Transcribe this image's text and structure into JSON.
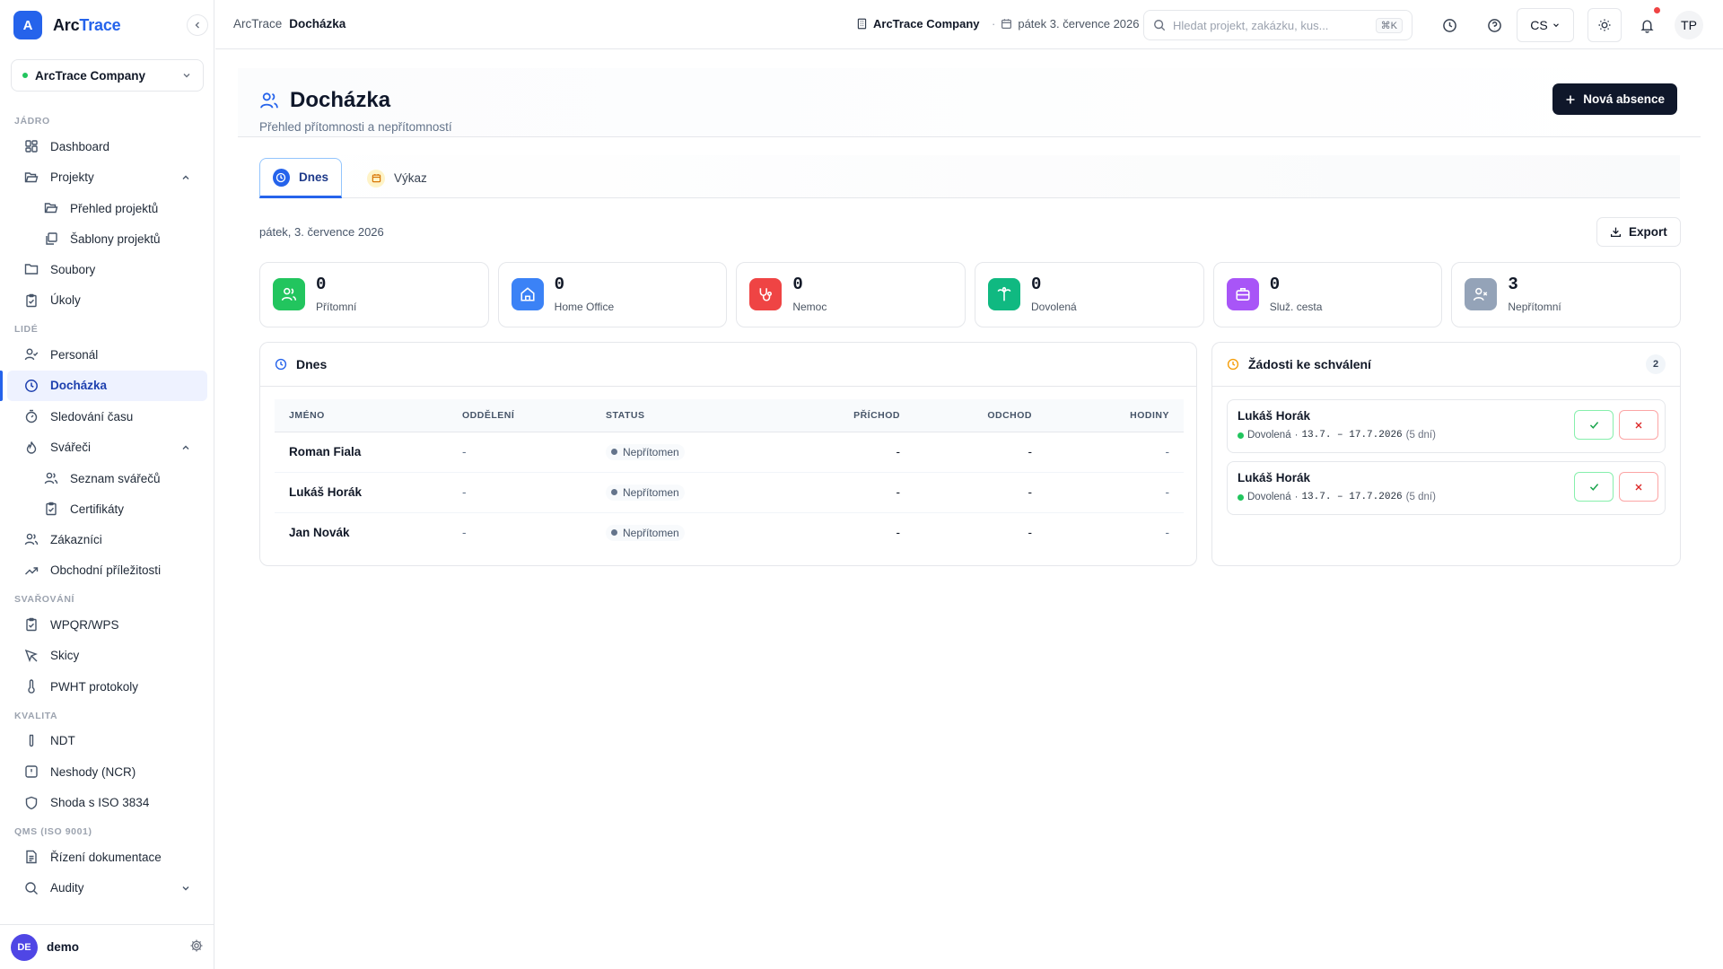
{
  "brand": {
    "logo_letter": "A",
    "name_a": "Arc",
    "name_b": "Trace"
  },
  "sidebar": {
    "company": "ArcTrace Company",
    "sections": {
      "core": "JÁDRO",
      "people": "LIDÉ",
      "welding": "SVAŘOVÁNÍ",
      "quality": "KVALITA",
      "qms": "QMS (ISO 9001)"
    },
    "items": {
      "dashboard": "Dashboard",
      "projects": "Projekty",
      "projects_overview": "Přehled projektů",
      "projects_templates": "Šablony projektů",
      "files": "Soubory",
      "tasks": "Úkoly",
      "personnel": "Personál",
      "attendance": "Docházka",
      "time_tracking": "Sledování času",
      "welders": "Svářeči",
      "welders_list": "Seznam svářečů",
      "certificates": "Certifikáty",
      "customers": "Zákazníci",
      "opportunities": "Obchodní příležitosti",
      "wpqr": "WPQR/WPS",
      "sketches": "Skicy",
      "pwht": "PWHT protokoly",
      "ndt": "NDT",
      "ncr": "Neshody (NCR)",
      "iso3834": "Shoda s ISO 3834",
      "doc_control": "Řízení dokumentace",
      "audits": "Audity"
    },
    "footer": {
      "avatar": "DE",
      "user": "demo"
    }
  },
  "header": {
    "breadcrumb_root": "ArcTrace",
    "breadcrumb_current": "Docházka",
    "company": "ArcTrace Company",
    "date": "pátek 3. července 2026",
    "search_placeholder": "Hledat projekt, zakázku, kus...",
    "search_shortcut": "⌘K",
    "language": "CS",
    "user_initials": "TP"
  },
  "page": {
    "title": "Docházka",
    "subtitle": "Přehled přítomnosti a nepřítomností",
    "new_absence_label": "Nová absence",
    "tabs": {
      "today": "Dnes",
      "report": "Výkaz"
    },
    "date_line": "pátek, 3. července 2026",
    "export_label": "Export"
  },
  "stats": [
    {
      "value": "0",
      "label": "Přítomní",
      "color": "#22c55e",
      "icon": "users-icon"
    },
    {
      "value": "0",
      "label": "Home Office",
      "color": "#3b82f6",
      "icon": "home-icon"
    },
    {
      "value": "0",
      "label": "Nemoc",
      "color": "#ef4444",
      "icon": "stethoscope-icon"
    },
    {
      "value": "0",
      "label": "Dovolená",
      "color": "#10b981",
      "icon": "palm-tree-icon"
    },
    {
      "value": "0",
      "label": "Služ. cesta",
      "color": "#a855f7",
      "icon": "briefcase-icon"
    },
    {
      "value": "3",
      "label": "Nepřítomní",
      "color": "#94a3b8",
      "icon": "user-x-icon"
    }
  ],
  "today_card": {
    "title": "Dnes",
    "columns": {
      "name": "JMÉNO",
      "department": "ODDĚLENÍ",
      "status": "STATUS",
      "arrival": "PŘÍCHOD",
      "departure": "ODCHOD",
      "hours": "HODINY"
    },
    "rows": [
      {
        "name": "Roman Fiala",
        "department": "-",
        "status": "Nepřítomen",
        "arrival": "-",
        "departure": "-",
        "hours": "-"
      },
      {
        "name": "Lukáš Horák",
        "department": "-",
        "status": "Nepřítomen",
        "arrival": "-",
        "departure": "-",
        "hours": "-"
      },
      {
        "name": "Jan Novák",
        "department": "-",
        "status": "Nepřítomen",
        "arrival": "-",
        "departure": "-",
        "hours": "-"
      }
    ]
  },
  "requests_card": {
    "title": "Žádosti ke schválení",
    "count": "2",
    "items": [
      {
        "name": "Lukáš Horák",
        "type": "Dovolená",
        "separator": "·",
        "range": "13.7. – 17.7.2026",
        "days": "(5 dní)"
      },
      {
        "name": "Lukáš Horák",
        "type": "Dovolená",
        "separator": "·",
        "range": "13.7. – 17.7.2026",
        "days": "(5 dní)"
      }
    ]
  }
}
